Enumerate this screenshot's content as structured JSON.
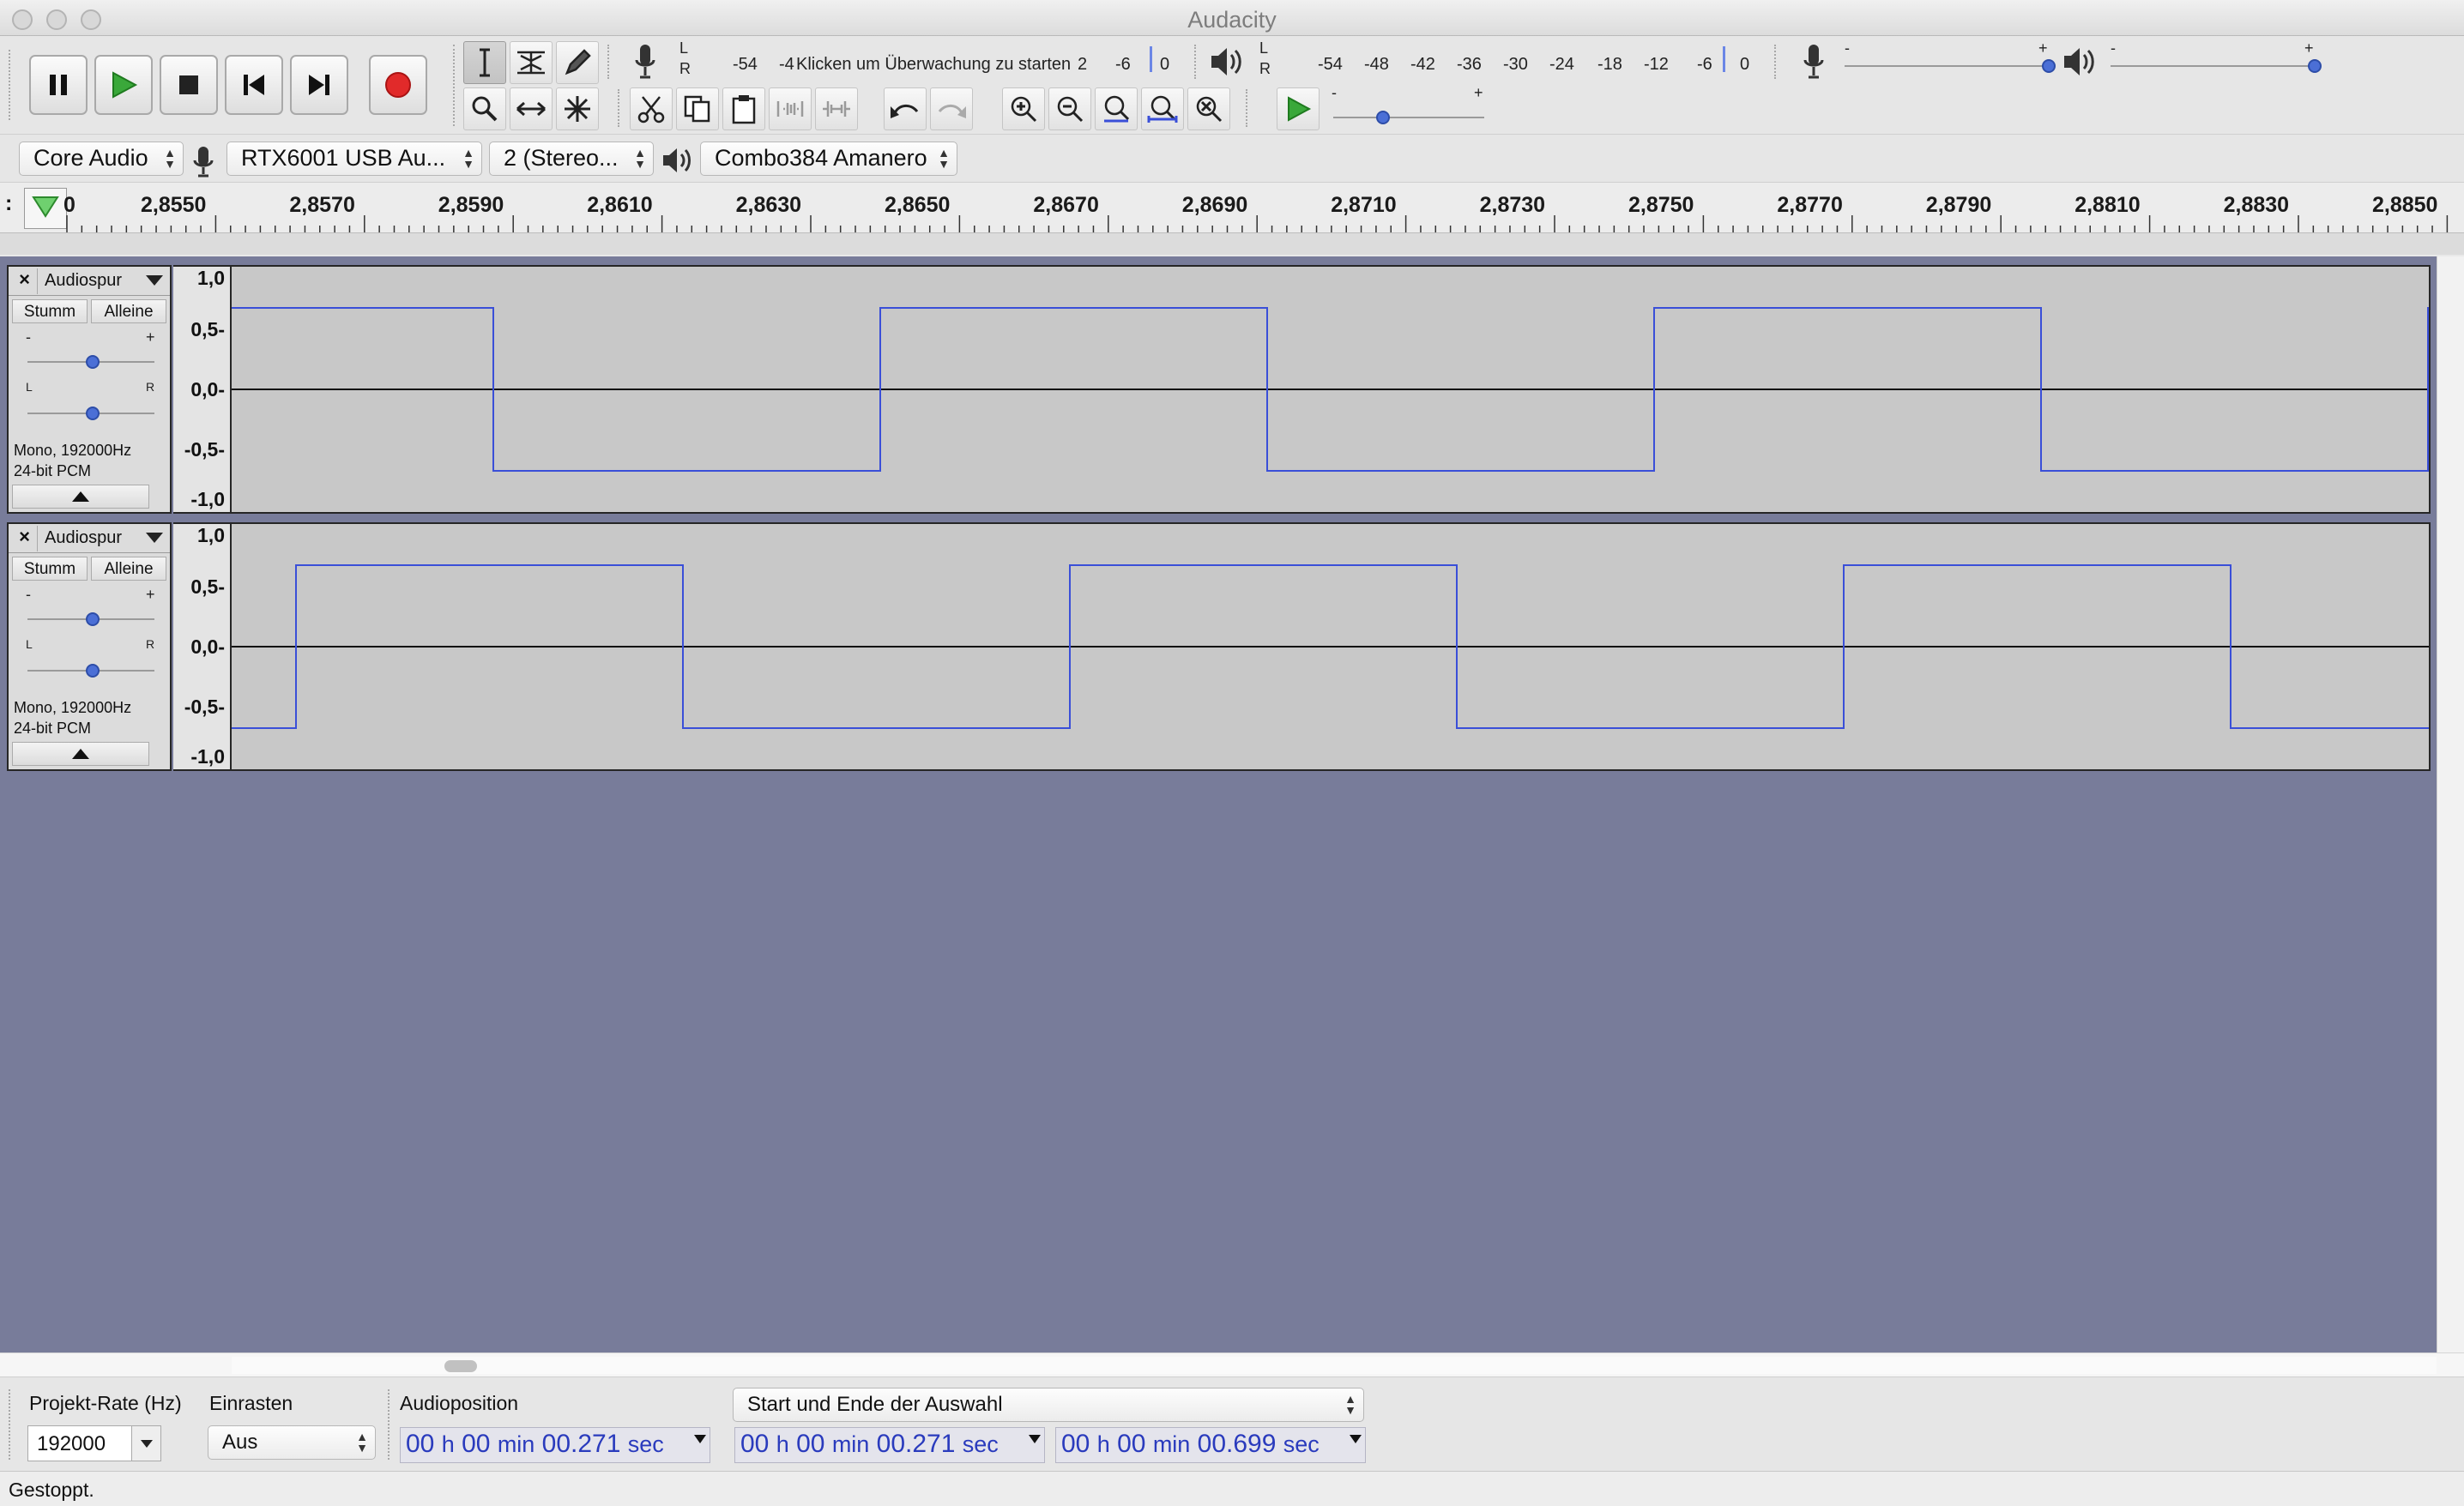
{
  "window": {
    "title": "Audacity"
  },
  "toolbar": {
    "rec_meter_hint": "Klicken um Überwachung zu starten",
    "rec_meter_scale": [
      "-54",
      "-4",
      "2",
      "-6",
      "0"
    ],
    "play_meter_scale": [
      "-54",
      "-48",
      "-42",
      "-36",
      "-30",
      "-24",
      "-18",
      "-12",
      "-6",
      "0"
    ],
    "lr_left": "L",
    "lr_right": "R",
    "slider_minus": "-",
    "slider_plus": "+"
  },
  "devices": {
    "host": "Core Audio",
    "input_device": "RTX6001 USB Au...",
    "channels": "2 (Stereo...",
    "output_device": "Combo384 Amanero"
  },
  "ruler": {
    "left_stub": "0",
    "ticks": [
      "2,8550",
      "2,8570",
      "2,8590",
      "2,8610",
      "2,8630",
      "2,8650",
      "2,8670",
      "2,8690",
      "2,8710",
      "2,8730",
      "2,8750",
      "2,8770",
      "2,8790",
      "2,8810",
      "2,8830",
      "2,8850"
    ]
  },
  "tracks": [
    {
      "name": "Audiospur",
      "mute": "Stumm",
      "solo": "Alleine",
      "info_line1": "Mono, 192000Hz",
      "info_line2": "24-bit PCM",
      "scale": [
        "1,0",
        "0,5-",
        "0,0-",
        "-0,5-",
        "-1,0"
      ],
      "gain_minus": "-",
      "gain_plus": "+",
      "pan_left": "L",
      "pan_right": "R"
    },
    {
      "name": "Audiospur",
      "mute": "Stumm",
      "solo": "Alleine",
      "info_line1": "Mono, 192000Hz",
      "info_line2": "24-bit PCM",
      "scale": [
        "1,0",
        "0,5-",
        "0,0-",
        "-0,5-",
        "-1,0"
      ],
      "gain_minus": "-",
      "gain_plus": "+",
      "pan_left": "L",
      "pan_right": "R"
    }
  ],
  "selection": {
    "rate_label": "Projekt-Rate (Hz)",
    "rate_value": "192000",
    "snap_label": "Einrasten",
    "snap_value": "Aus",
    "position_label": "Audioposition",
    "mode": "Start und Ende der Auswahl",
    "audio_position": {
      "h": "00",
      "m": "00",
      "s": "00.271"
    },
    "start": {
      "h": "00",
      "m": "00",
      "s": "00.271"
    },
    "end": {
      "h": "00",
      "m": "00",
      "s": "00.699"
    },
    "unit_h": "h",
    "unit_m": "min",
    "unit_s": "sec"
  },
  "status": {
    "text": "Gestoppt."
  },
  "colors": {
    "waveform": "#3a4fd8",
    "background": "#787c9a",
    "record": "#e12a2a",
    "play": "#3aa83a"
  }
}
